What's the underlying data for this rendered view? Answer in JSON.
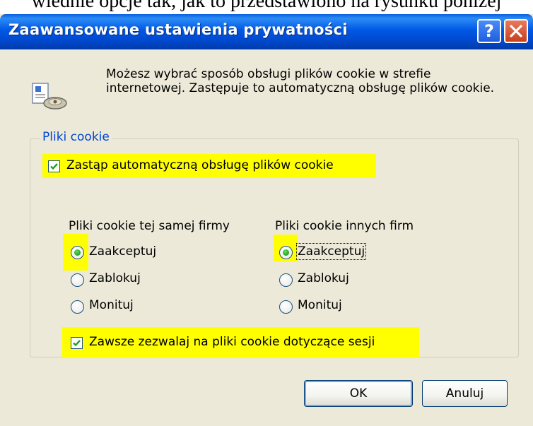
{
  "background_text": "wiednie opcje tak, jak to przedstawiono na rysunku poniżej",
  "dialog": {
    "title": "Zaawansowane ustawienia prywatności",
    "help_button": "?",
    "info_text": "Możesz wybrać sposób obsługi plików cookie w strefie internetowej. Zastępuje to automatyczną obsługę plików cookie.",
    "group": {
      "title": "Pliki cookie",
      "override_checkbox": {
        "label": "Zastąp automatyczną obsługę plików cookie",
        "checked": true
      },
      "first_party": {
        "heading": "Pliki cookie tej samej firmy",
        "options": [
          "Zaakceptuj",
          "Zablokuj",
          "Monituj"
        ],
        "selected": "Zaakceptuj"
      },
      "third_party": {
        "heading": "Pliki cookie innych firm",
        "options": [
          "Zaakceptuj",
          "Zablokuj",
          "Monituj"
        ],
        "selected": "Zaakceptuj"
      },
      "session_checkbox": {
        "label": "Zawsze zezwalaj na pliki cookie dotyczące sesji",
        "checked": true
      }
    },
    "buttons": {
      "ok": "OK",
      "cancel": "Anuluj"
    }
  },
  "colors": {
    "title_bar": "#0058e6",
    "highlight": "#ffff00",
    "dialog_bg": "#ece9d8",
    "group_title": "#0046d5"
  }
}
